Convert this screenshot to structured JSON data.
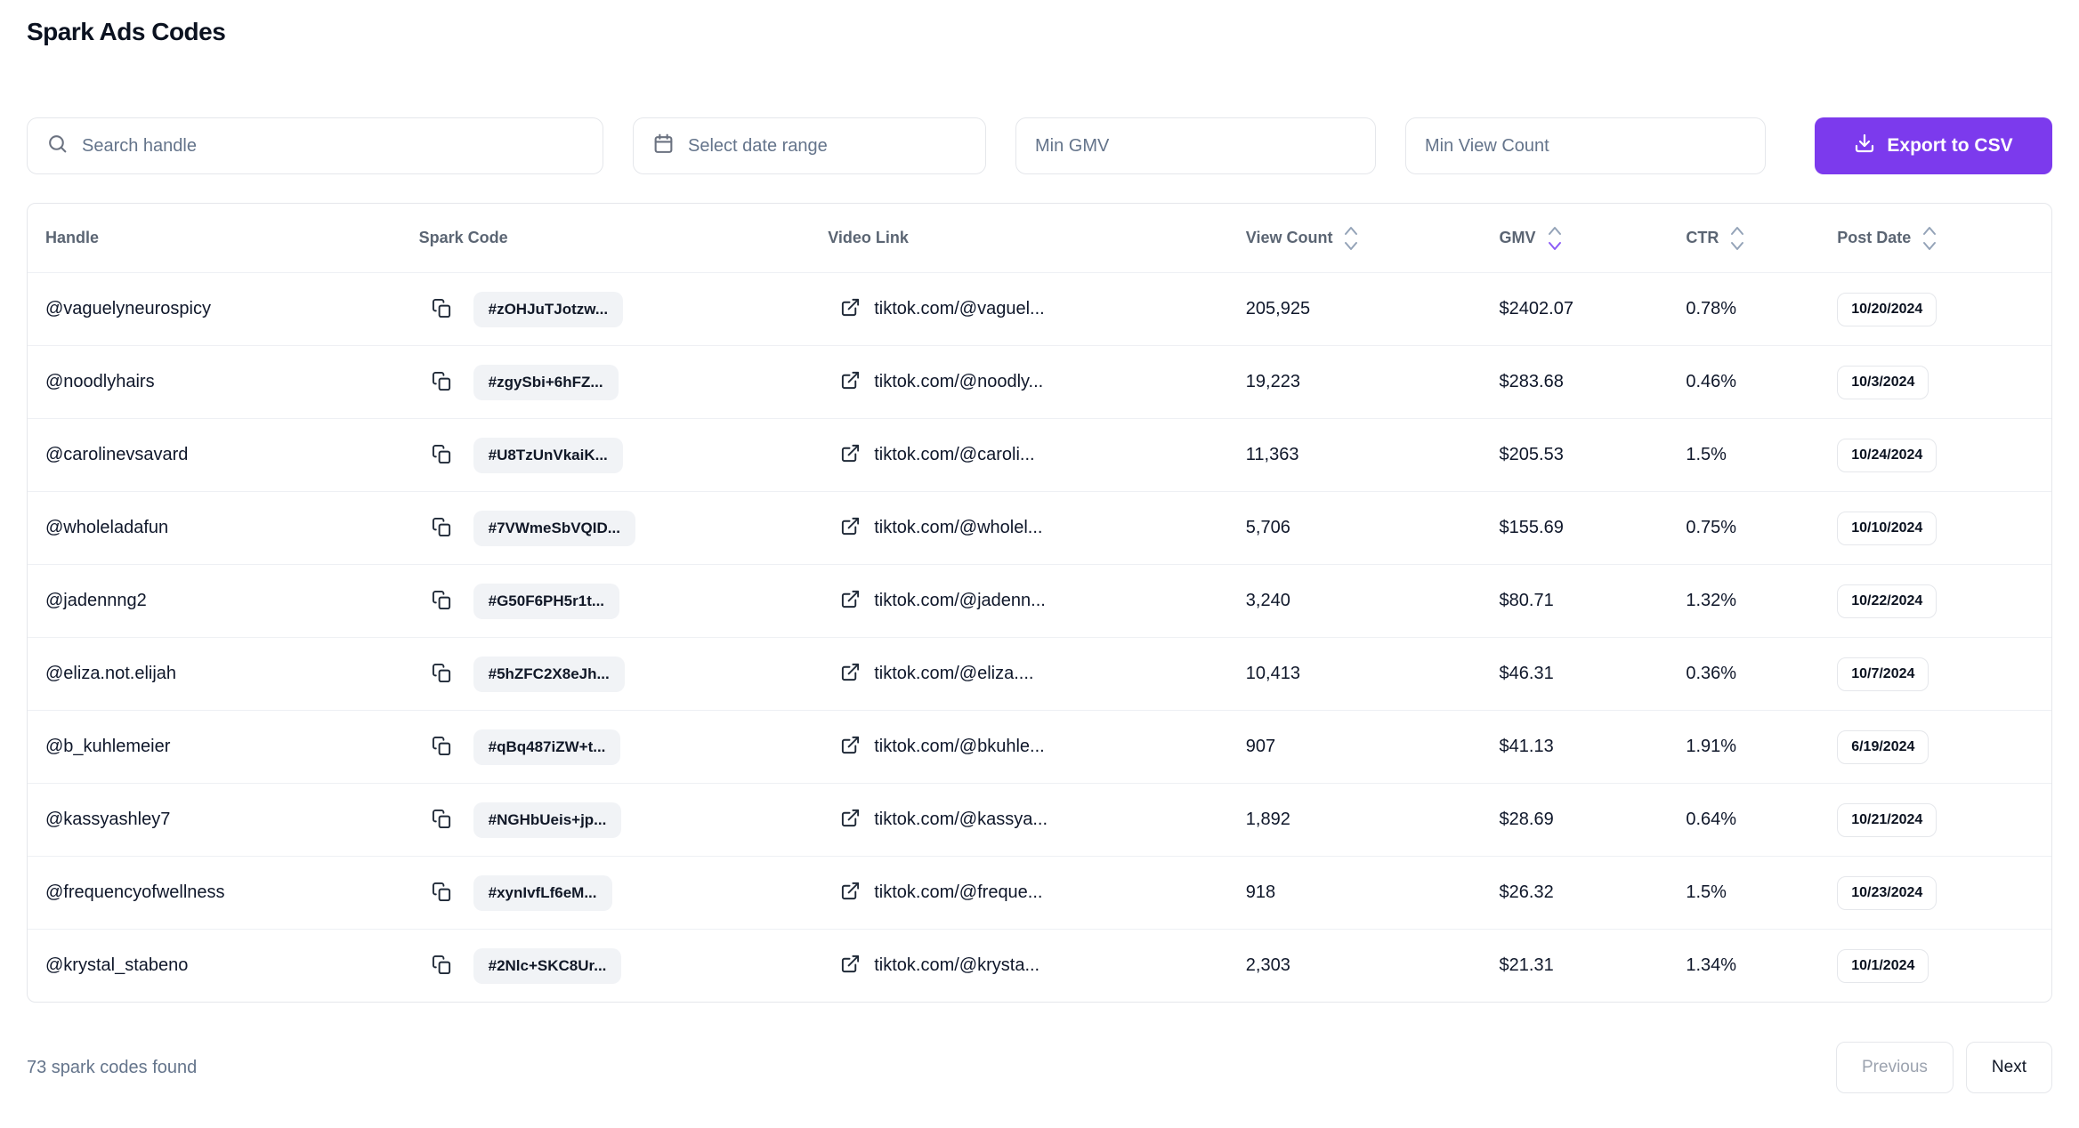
{
  "page": {
    "title": "Spark Ads Codes"
  },
  "filters": {
    "search_placeholder": "Search handle",
    "date_range_placeholder": "Select date range",
    "min_gmv_placeholder": "Min GMV",
    "min_view_count_placeholder": "Min View Count",
    "export_button_label": "Export to CSV"
  },
  "table": {
    "columns": [
      {
        "label": "Handle",
        "sortable": false
      },
      {
        "label": "Spark Code",
        "sortable": false
      },
      {
        "label": "Video Link",
        "sortable": false
      },
      {
        "label": "View Count",
        "sortable": true
      },
      {
        "label": "GMV",
        "sortable": true
      },
      {
        "label": "CTR",
        "sortable": true
      },
      {
        "label": "Post Date",
        "sortable": true
      }
    ],
    "sort": {
      "column": "GMV",
      "direction": "desc"
    },
    "rows": [
      {
        "handle": "@vaguelyneurospicy",
        "spark_code": "#zOHJuTJotzw...",
        "video_link": "tiktok.com/@vaguel...",
        "view_count": "205,925",
        "gmv": "$2402.07",
        "ctr": "0.78%",
        "post_date": "10/20/2024"
      },
      {
        "handle": "@noodlyhairs",
        "spark_code": "#zgySbi+6hFZ...",
        "video_link": "tiktok.com/@noodly...",
        "view_count": "19,223",
        "gmv": "$283.68",
        "ctr": "0.46%",
        "post_date": "10/3/2024"
      },
      {
        "handle": "@carolinevsavard",
        "spark_code": "#U8TzUnVkaiK...",
        "video_link": "tiktok.com/@caroli...",
        "view_count": "11,363",
        "gmv": "$205.53",
        "ctr": "1.5%",
        "post_date": "10/24/2024"
      },
      {
        "handle": "@wholeladafun",
        "spark_code": "#7VWmeSbVQID...",
        "video_link": "tiktok.com/@wholel...",
        "view_count": "5,706",
        "gmv": "$155.69",
        "ctr": "0.75%",
        "post_date": "10/10/2024"
      },
      {
        "handle": "@jadennng2",
        "spark_code": "#G50F6PH5r1t...",
        "video_link": "tiktok.com/@jadenn...",
        "view_count": "3,240",
        "gmv": "$80.71",
        "ctr": "1.32%",
        "post_date": "10/22/2024"
      },
      {
        "handle": "@eliza.not.elijah",
        "spark_code": "#5hZFC2X8eJh...",
        "video_link": "tiktok.com/@eliza....",
        "view_count": "10,413",
        "gmv": "$46.31",
        "ctr": "0.36%",
        "post_date": "10/7/2024"
      },
      {
        "handle": "@b_kuhlemeier",
        "spark_code": "#qBq487iZW+t...",
        "video_link": "tiktok.com/@bkuhle...",
        "view_count": "907",
        "gmv": "$41.13",
        "ctr": "1.91%",
        "post_date": "6/19/2024"
      },
      {
        "handle": "@kassyashley7",
        "spark_code": "#NGHbUeis+jp...",
        "video_link": "tiktok.com/@kassya...",
        "view_count": "1,892",
        "gmv": "$28.69",
        "ctr": "0.64%",
        "post_date": "10/21/2024"
      },
      {
        "handle": "@frequencyofwellness",
        "spark_code": "#xynIvfLf6eM...",
        "video_link": "tiktok.com/@freque...",
        "view_count": "918",
        "gmv": "$26.32",
        "ctr": "1.5%",
        "post_date": "10/23/2024"
      },
      {
        "handle": "@krystal_stabeno",
        "spark_code": "#2Nlc+SKC8Ur...",
        "video_link": "tiktok.com/@krysta...",
        "view_count": "2,303",
        "gmv": "$21.31",
        "ctr": "1.34%",
        "post_date": "10/1/2024"
      }
    ]
  },
  "footer": {
    "results_text": "73 spark codes found",
    "previous_label": "Previous",
    "next_label": "Next"
  },
  "colors": {
    "accent": "#7c3aed",
    "sort_active": "#8b5cf6"
  }
}
